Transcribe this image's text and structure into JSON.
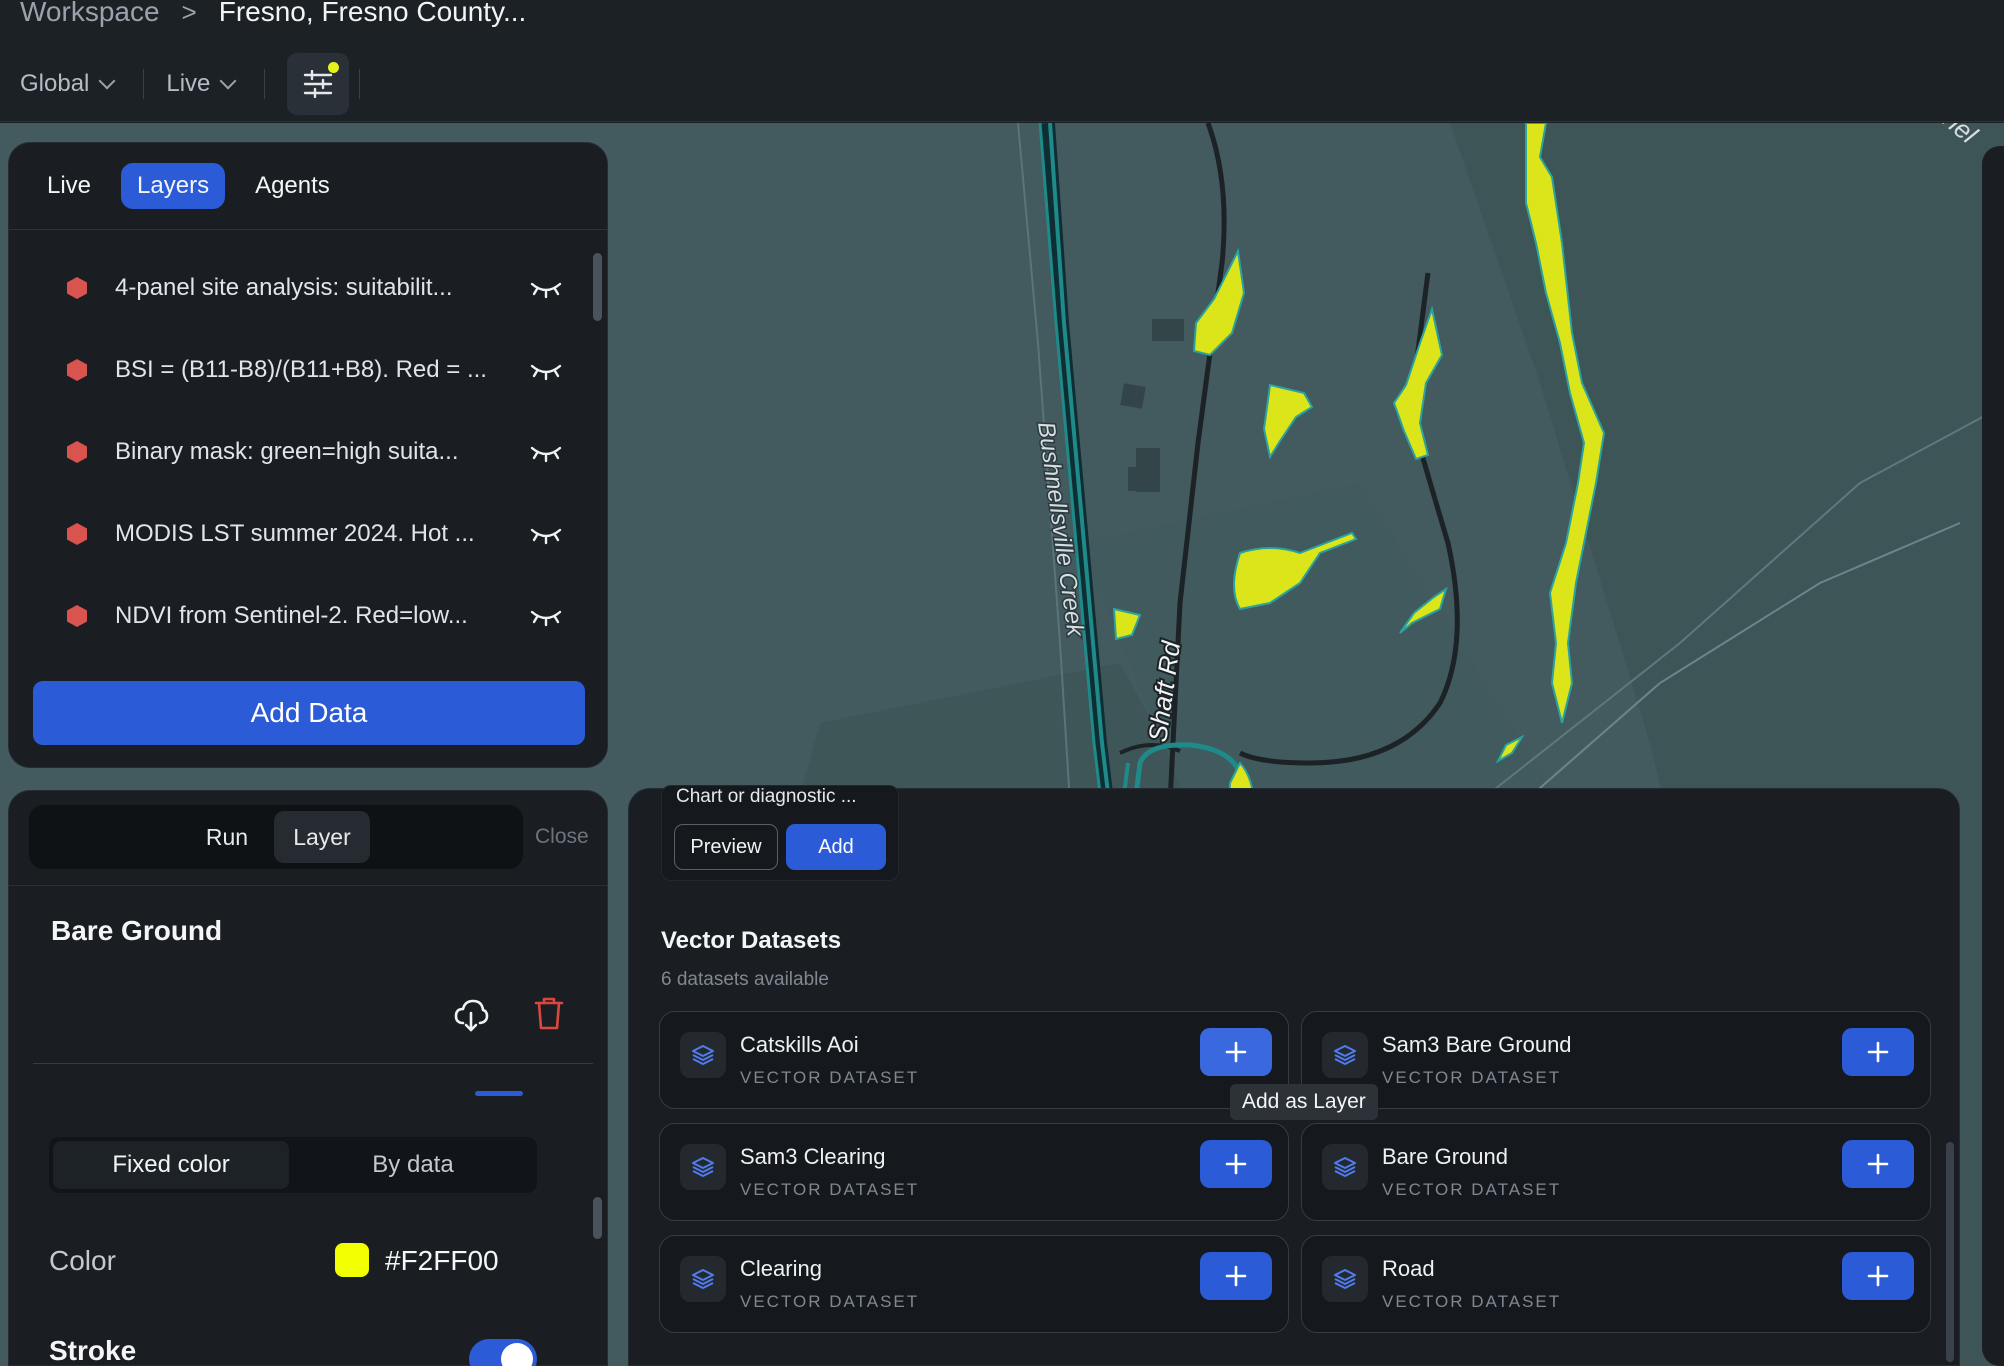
{
  "breadcrumb": {
    "workspace": "Workspace",
    "separator": ">",
    "location": "Fresno, Fresno County..."
  },
  "toolbar": {
    "scope_label": "Global",
    "mode_label": "Live"
  },
  "map": {
    "labels": {
      "creek": "Bushnellsville Creek",
      "road": "Shaft Rd",
      "edge_fragment": "nnel"
    },
    "highlight_color": "#F2FF00"
  },
  "layers_panel": {
    "tabs": [
      {
        "label": "Live"
      },
      {
        "label": "Layers",
        "active": true
      },
      {
        "label": "Agents"
      }
    ],
    "layers": [
      {
        "name": "4-panel site analysis: suitabilit..."
      },
      {
        "name": "BSI = (B11-B8)/(B11+B8). Red = ..."
      },
      {
        "name": "Binary mask: green=high suita..."
      },
      {
        "name": "MODIS LST summer 2024. Hot ..."
      },
      {
        "name": "NDVI from Sentinel-2. Red=low..."
      }
    ],
    "layer_icon_color": "#d9534f",
    "add_data_label": "Add Data"
  },
  "style_panel": {
    "segment": {
      "run_label": "Run",
      "layer_label": "Layer"
    },
    "close_label": "Close",
    "layer_title": "Bare Ground",
    "mode": {
      "fixed_label": "Fixed color",
      "by_data_label": "By data"
    },
    "color_label": "Color",
    "color_value": "#F2FF00",
    "stroke_label": "Stroke",
    "stroke_enabled": true
  },
  "data_panel": {
    "chart_card": {
      "title": "Chart or diagnostic ...",
      "preview_label": "Preview",
      "add_label": "Add"
    },
    "vector_title": "Vector Datasets",
    "vector_subtitle": "6 datasets available",
    "datasets": [
      {
        "name": "Catskills Aoi",
        "type": "VECTOR DATASET"
      },
      {
        "name": "Sam3 Bare Ground",
        "type": "VECTOR DATASET"
      },
      {
        "name": "Sam3 Clearing",
        "type": "VECTOR DATASET"
      },
      {
        "name": "Bare Ground",
        "type": "VECTOR DATASET"
      },
      {
        "name": "Clearing",
        "type": "VECTOR DATASET"
      },
      {
        "name": "Road",
        "type": "VECTOR DATASET"
      }
    ],
    "tooltip": "Add as Layer"
  }
}
